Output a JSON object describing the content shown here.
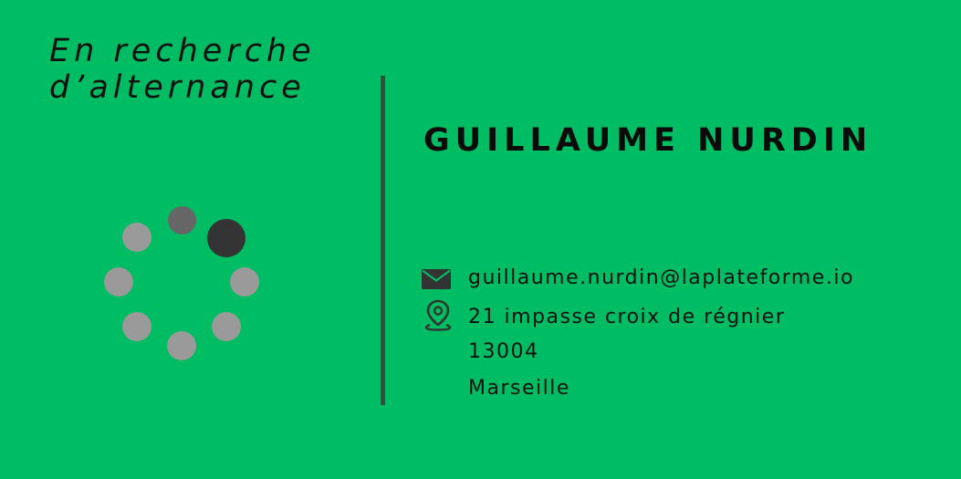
{
  "tagline": {
    "line1": "En recherche",
    "line2": "d’alternance"
  },
  "spinner": {
    "icon": "loading-spinner-icon"
  },
  "profile": {
    "name": "GUILLAUME NURDIN"
  },
  "contact": {
    "email": "guillaume.nurdin@laplateforme.io",
    "email_icon": "envelope-icon",
    "street": "21 impasse croix de régnier",
    "location_icon": "map-pin-icon",
    "postal_code": "13004",
    "city": "Marseille"
  },
  "colors": {
    "background": "#00bc62",
    "divider": "#3c4a44",
    "text": "#111111"
  }
}
